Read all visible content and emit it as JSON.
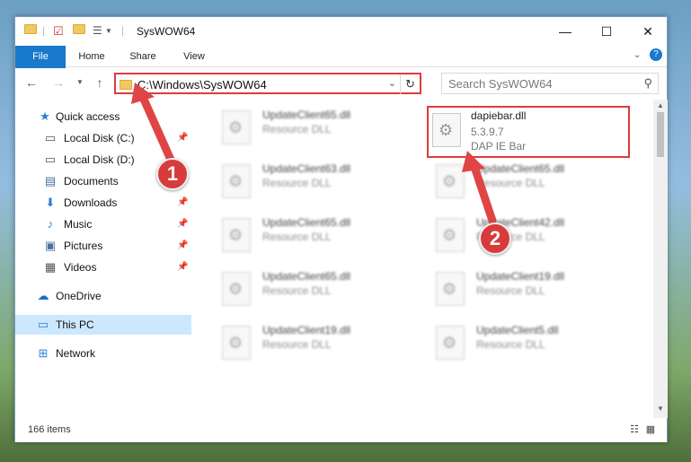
{
  "window": {
    "title": "SysWOW64",
    "controls": {
      "minimize": "—",
      "maximize": "☐",
      "close": "✕"
    }
  },
  "ribbon": {
    "tabs": [
      "File",
      "Home",
      "Share",
      "View"
    ]
  },
  "address": {
    "path": "C:\\Windows\\SysWOW64",
    "search_placeholder": "Search SysWOW64"
  },
  "nav": {
    "items": [
      {
        "label": "Quick access",
        "icon": "star-icon",
        "pinned": false
      },
      {
        "label": "Local Disk (C:)",
        "icon": "drive-icon",
        "pinned": true
      },
      {
        "label": "Local Disk (D:)",
        "icon": "drive-icon",
        "pinned": false
      },
      {
        "label": "Documents",
        "icon": "documents-icon",
        "pinned": true
      },
      {
        "label": "Downloads",
        "icon": "download-icon",
        "pinned": true
      },
      {
        "label": "Music",
        "icon": "music-icon",
        "pinned": true
      },
      {
        "label": "Pictures",
        "icon": "pictures-icon",
        "pinned": true
      },
      {
        "label": "Videos",
        "icon": "videos-icon",
        "pinned": true
      },
      {
        "label": "OneDrive",
        "icon": "cloud-icon",
        "pinned": false
      },
      {
        "label": "This PC",
        "icon": "computer-icon",
        "pinned": false,
        "selected": true
      },
      {
        "label": "Network",
        "icon": "network-icon",
        "pinned": false
      }
    ]
  },
  "files": {
    "left": [
      {
        "name": "UpdateClient65.dll",
        "type": "Resource DLL"
      },
      {
        "name": "UpdateClient63.dll",
        "type": "Resource DLL"
      },
      {
        "name": "UpdateClient65.dll",
        "type": "Resource DLL"
      },
      {
        "name": "UpdateClient65.dll",
        "type": "Resource DLL"
      },
      {
        "name": "UpdateClient19.dll",
        "type": "Resource DLL"
      }
    ],
    "right": [
      {
        "name": "dapiebar.dll",
        "version": "5.3.9.7",
        "desc": "DAP IE Bar",
        "highlighted": true
      },
      {
        "name": "UpdateClient65.dll",
        "type": "Resource DLL"
      },
      {
        "name": "UpdateClient42.dll",
        "type": "Resource DLL"
      },
      {
        "name": "UpdateClient19.dll",
        "type": "Resource DLL"
      },
      {
        "name": "UpdateClient5.dll",
        "type": "Resource DLL"
      }
    ]
  },
  "status": {
    "count": "166 items"
  },
  "callouts": {
    "one": "1",
    "two": "2"
  },
  "colors": {
    "accent": "#1979ca",
    "callout": "#d83b3b",
    "selected": "#cce8ff"
  }
}
